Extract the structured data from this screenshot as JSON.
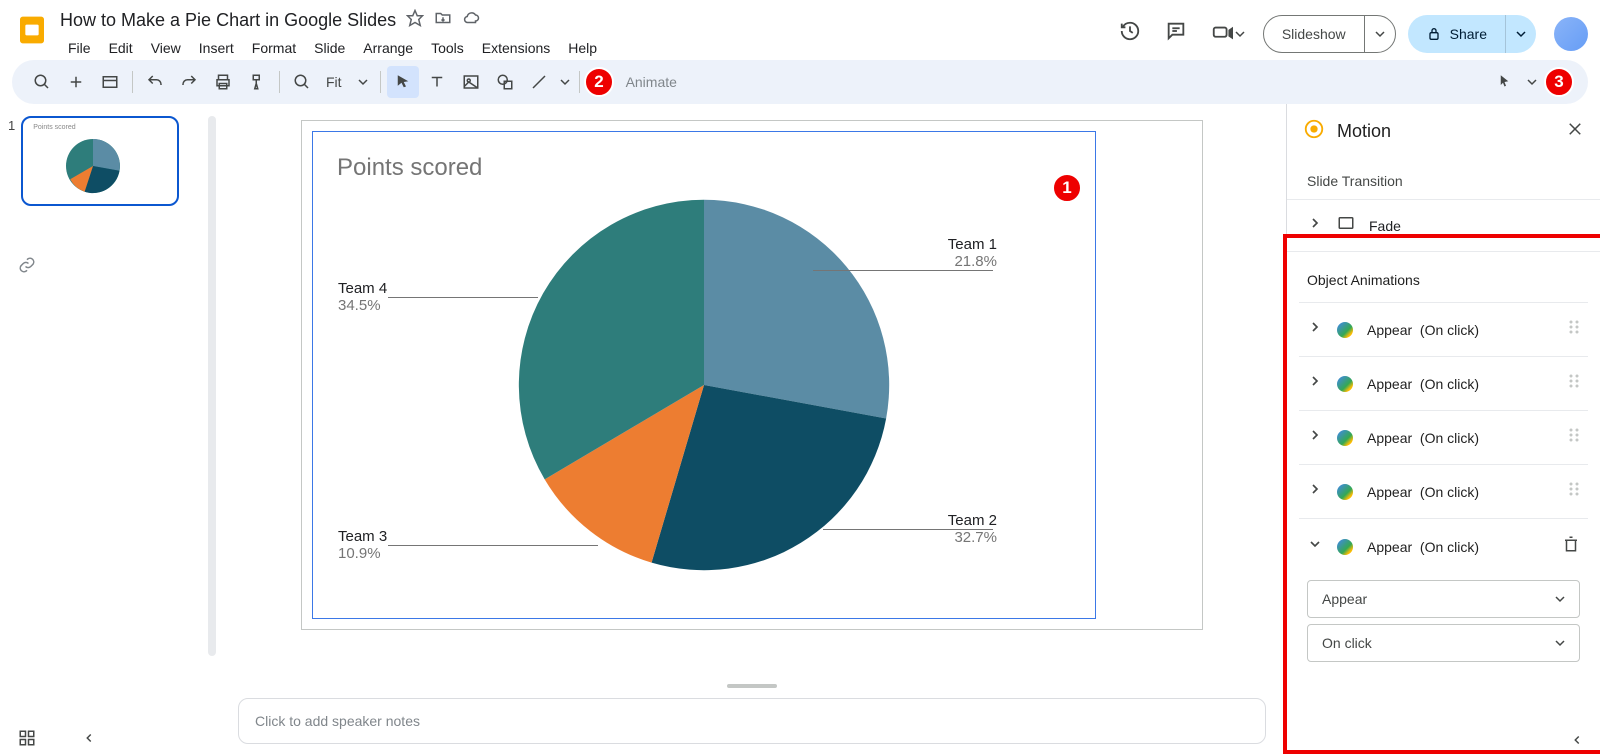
{
  "doc": {
    "title": "How to Make a Pie Chart in Google Slides"
  },
  "menus": [
    "File",
    "Edit",
    "View",
    "Insert",
    "Format",
    "Slide",
    "Arrange",
    "Tools",
    "Extensions",
    "Help"
  ],
  "toolbar": {
    "zoom": "Fit",
    "animate": "Animate"
  },
  "header_buttons": {
    "slideshow": "Slideshow",
    "share": "Share"
  },
  "chart_data": {
    "type": "pie",
    "title": "Points scored",
    "series": [
      {
        "name": "Team 1",
        "pct": 21.8,
        "color": "#5b8ca5",
        "label_pct": "21.8%"
      },
      {
        "name": "Team 2",
        "pct": 32.7,
        "color": "#0e4d64",
        "label_pct": "32.7%"
      },
      {
        "name": "Team 3",
        "pct": 10.9,
        "color": "#ed7d31",
        "label_pct": "10.9%"
      },
      {
        "name": "Team 4",
        "pct": 34.5,
        "color": "#2e7d7b",
        "label_pct": "34.5%"
      }
    ]
  },
  "notes_placeholder": "Click to add speaker notes",
  "motion": {
    "panel_title": "Motion",
    "slide_transition_label": "Slide Transition",
    "transition_type": "Fade",
    "object_animations_label": "Object Animations",
    "animations": [
      {
        "name": "Appear",
        "trigger": "(On click)",
        "expanded": false
      },
      {
        "name": "Appear",
        "trigger": "(On click)",
        "expanded": false
      },
      {
        "name": "Appear",
        "trigger": "(On click)",
        "expanded": false
      },
      {
        "name": "Appear",
        "trigger": "(On click)",
        "expanded": false
      },
      {
        "name": "Appear",
        "trigger": "(On click)",
        "expanded": true
      }
    ],
    "effect_select": "Appear",
    "trigger_select": "On click"
  },
  "badges": {
    "one": "1",
    "two": "2",
    "three": "3"
  },
  "slide_number": "1"
}
